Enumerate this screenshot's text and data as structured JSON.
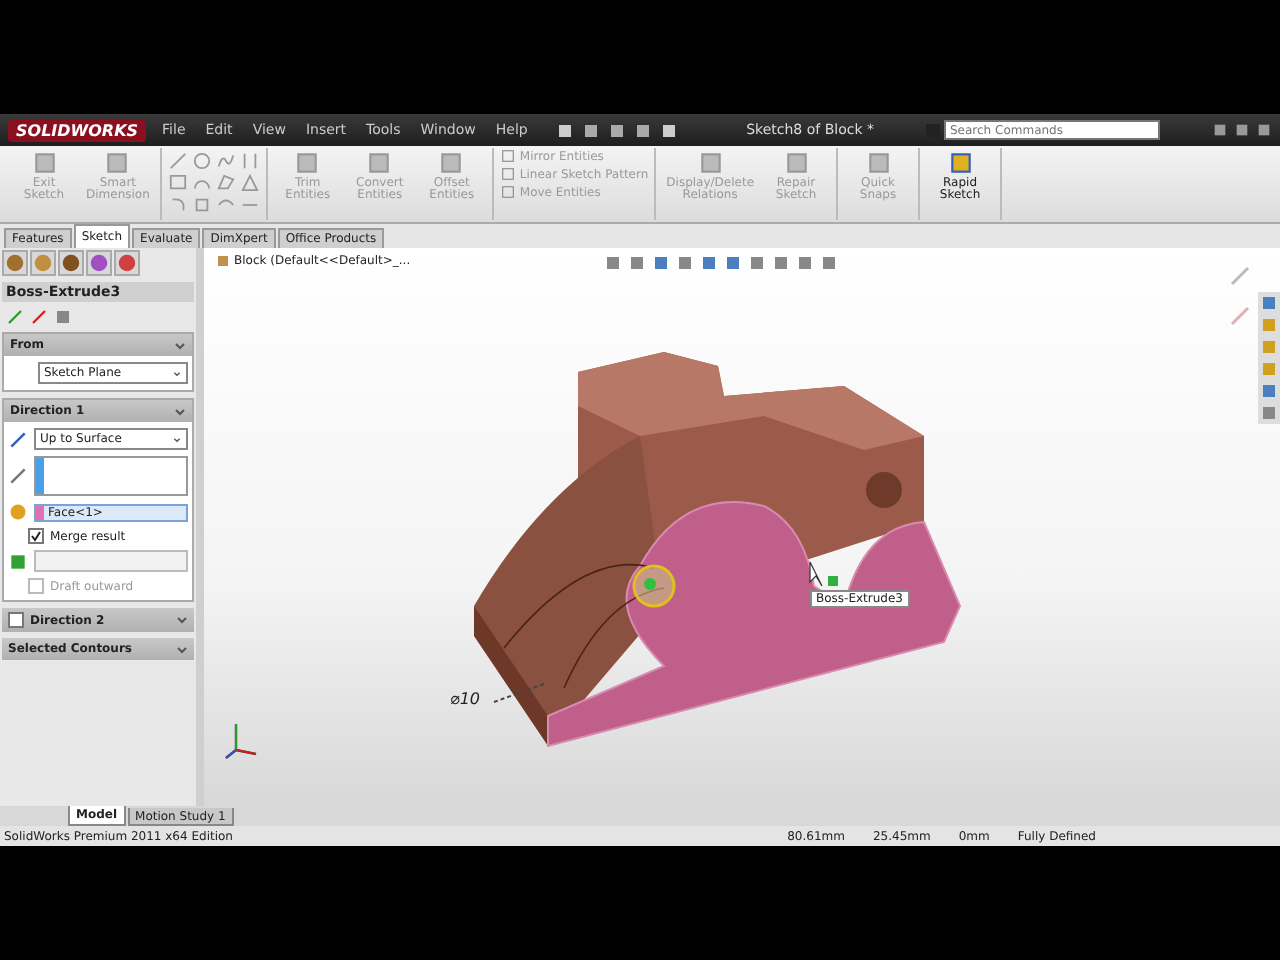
{
  "title_bar": {
    "logo": "SOLIDWORKS",
    "menus": [
      "File",
      "Edit",
      "View",
      "Insert",
      "Tools",
      "Window",
      "Help"
    ],
    "document_title": "Sketch8 of Block *",
    "search": {
      "placeholder": "Search Commands"
    }
  },
  "ribbon": {
    "groups": [
      {
        "kind": "large",
        "tools": [
          {
            "label": "Exit Sketch",
            "disabled": true
          },
          {
            "label": "Smart Dimension",
            "disabled": true
          }
        ]
      },
      {
        "kind": "entity_grid"
      },
      {
        "kind": "large",
        "tools": [
          {
            "label": "Trim Entities",
            "disabled": true
          },
          {
            "label": "Convert Entities",
            "disabled": true
          },
          {
            "label": "Offset Entities",
            "disabled": true
          }
        ]
      },
      {
        "kind": "stacked",
        "tools": [
          {
            "label": "Mirror Entities",
            "disabled": true
          },
          {
            "label": "Linear Sketch Pattern",
            "disabled": true
          },
          {
            "label": "Move Entities",
            "disabled": true
          }
        ]
      },
      {
        "kind": "large",
        "tools": [
          {
            "label": "Display/Delete Relations",
            "disabled": true
          },
          {
            "label": "Repair Sketch",
            "disabled": true
          }
        ]
      },
      {
        "kind": "large",
        "tools": [
          {
            "label": "Quick Snaps",
            "disabled": true
          }
        ]
      },
      {
        "kind": "large",
        "tools": [
          {
            "label": "Rapid Sketch",
            "disabled": false
          }
        ]
      }
    ]
  },
  "command_tabs": [
    {
      "label": "Features",
      "selected": false
    },
    {
      "label": "Sketch",
      "selected": true
    },
    {
      "label": "Evaluate",
      "selected": false
    },
    {
      "label": "DimXpert",
      "selected": false
    },
    {
      "label": "Office Products",
      "selected": false
    }
  ],
  "property_manager": {
    "title": "Boss-Extrude3",
    "from": {
      "header": "From",
      "value": "Sketch Plane"
    },
    "direction_1": {
      "header": "Direction 1",
      "end_condition": "Up to Surface",
      "face": "Face<1>",
      "merge_result": {
        "label": "Merge result",
        "checked": true
      },
      "draft_outward": {
        "label": "Draft outward",
        "checked": false,
        "disabled": true
      }
    },
    "direction_2": {
      "header": "Direction 2",
      "checked": false
    },
    "selected_contours": {
      "header": "Selected Contours"
    }
  },
  "feature_tree": {
    "root": "Block  (Default<<Default>_..."
  },
  "viewport": {
    "tooltip": "Boss-Extrude3",
    "dimension": "⌀10"
  },
  "model_tabs": [
    {
      "label": "Model",
      "selected": true
    },
    {
      "label": "Motion Study 1",
      "selected": false
    }
  ],
  "status_bar": {
    "product": "SolidWorks Premium 2011 x64 Edition",
    "fields": [
      "80.61mm",
      "25.45mm",
      "0mm",
      "Fully Defined"
    ]
  }
}
